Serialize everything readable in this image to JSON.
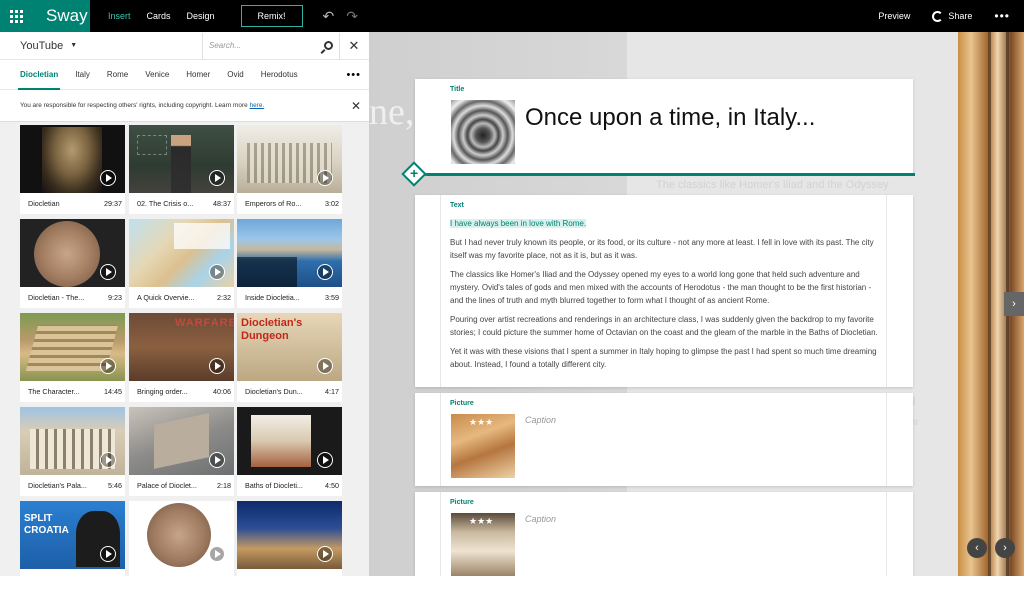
{
  "topbar": {
    "app_name": "Sway",
    "nav": [
      "Insert",
      "Cards",
      "Design"
    ],
    "remix": "Remix!",
    "undo_icon": "undo-icon",
    "redo_icon": "redo-icon",
    "preview": "Preview",
    "share": "Share",
    "more": "•••"
  },
  "left": {
    "source": "YouTube",
    "search_placeholder": "Search...",
    "keywords": [
      "Diocletian",
      "Italy",
      "Rome",
      "Venice",
      "Homer",
      "Ovid",
      "Herodotus"
    ],
    "kw_more": "•••",
    "notice_text": "You are responsible for respecting others' rights, including copyright. Learn more",
    "notice_link": "here.",
    "videos": [
      {
        "title": "Diocletian",
        "duration": "29:37"
      },
      {
        "title": "02. The Crisis o...",
        "duration": "48:37"
      },
      {
        "title": "Emperors of Ro...",
        "duration": "3:02"
      },
      {
        "title": "Diocletian - The...",
        "duration": "9:23"
      },
      {
        "title": "A Quick Overvie...",
        "duration": "2:32"
      },
      {
        "title": "Inside Diocletia...",
        "duration": "3:59"
      },
      {
        "title": "The Character...",
        "duration": "14:45"
      },
      {
        "title": "Bringing order...",
        "duration": "40:06"
      },
      {
        "title": "Diocletian's Dun...",
        "duration": "4:17"
      },
      {
        "title": "Diocletian's Pala...",
        "duration": "5:46"
      },
      {
        "title": "Palace of Dioclet...",
        "duration": "2:18"
      },
      {
        "title": "Baths of Diocleti...",
        "duration": "4:50"
      },
      {
        "title": "",
        "duration": ""
      },
      {
        "title": "",
        "duration": ""
      },
      {
        "title": "",
        "duration": ""
      }
    ],
    "thumb_overlays": {
      "warfare": "WARFARE",
      "dungeon": "Diocletian's Dungeon",
      "split": "SPLIT CROATIA"
    }
  },
  "canvas": {
    "ghost_letters": "ne, i",
    "ghost_line": "The classics like Homer's Iliad and the Odyssey",
    "ghost_bits": [
      "n",
      "e",
      "ur",
      "nd",
      "enr"
    ],
    "title_label": "Title",
    "title_text": "Once upon a time, in Italy...",
    "text_label": "Text",
    "text_highlight": "I have always been in love with Rome.",
    "paragraphs": [
      "But I had never truly known its people, or its food, or its culture - not any more at least. I fell in love with its past. The city itself was my favorite place, not as it is, but as it was.",
      "The classics like Homer's Iliad and the Odyssey opened my eyes to a world long gone that held such adventure and mystery. Ovid's tales of gods and men mixed with the accounts of Herodotus - the man thought to be the first historian - and the lines of truth and myth blurred together to form what I thought of as ancient Rome.",
      "Pouring over artist recreations and renderings in an architecture class, I was suddenly given the backdrop to my favorite stories; I could picture the summer home of Octavian on the coast and the gleam of the marble in the Baths of Diocletian.",
      "Yet it was with these visions that I spent a summer in Italy hoping to glimpse the past I had spent so much time dreaming about. Instead, I found a totally different city."
    ],
    "picture_label": "Picture",
    "caption_placeholder": "Caption",
    "stars": "★★★"
  }
}
